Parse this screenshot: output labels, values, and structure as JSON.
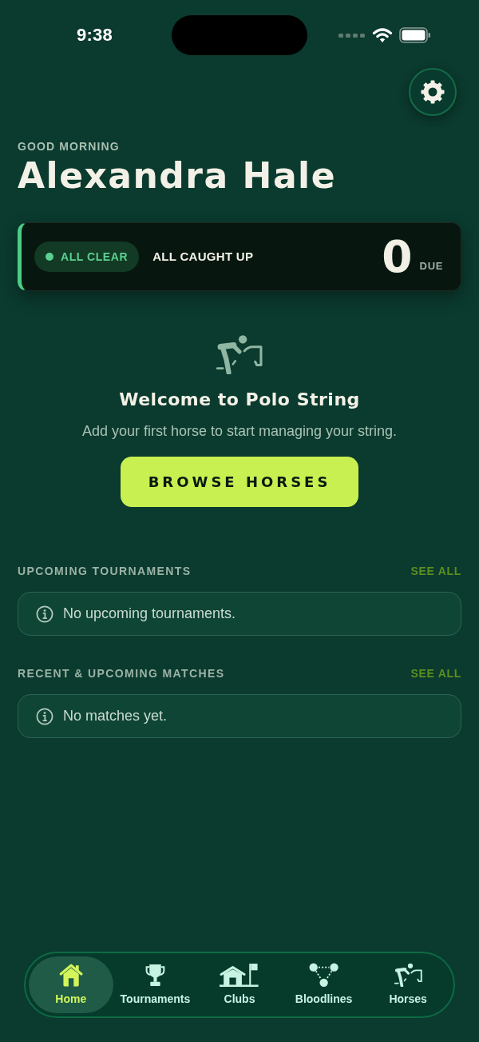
{
  "status_bar": {
    "time": "9:38"
  },
  "header": {
    "greeting": "GOOD MORNING",
    "name": "Alexandra Hale"
  },
  "status_card": {
    "badge": "ALL CLEAR",
    "message": "ALL CAUGHT UP",
    "count": "0",
    "count_label": "DUE"
  },
  "welcome": {
    "title": "Welcome to Polo String",
    "subtitle": "Add your first horse to start managing your string.",
    "button": "BROWSE HORSES"
  },
  "sections": [
    {
      "title": "UPCOMING TOURNAMENTS",
      "link": "SEE ALL",
      "empty_message": "No upcoming tournaments."
    },
    {
      "title": "RECENT & UPCOMING MATCHES",
      "link": "SEE ALL",
      "empty_message": "No matches yet."
    }
  ],
  "tab_bar": {
    "items": [
      {
        "label": "Home",
        "selected": true
      },
      {
        "label": "Tournaments",
        "selected": false
      },
      {
        "label": "Clubs",
        "selected": false
      },
      {
        "label": "Bloodlines",
        "selected": false
      },
      {
        "label": "Horses",
        "selected": false
      }
    ]
  }
}
